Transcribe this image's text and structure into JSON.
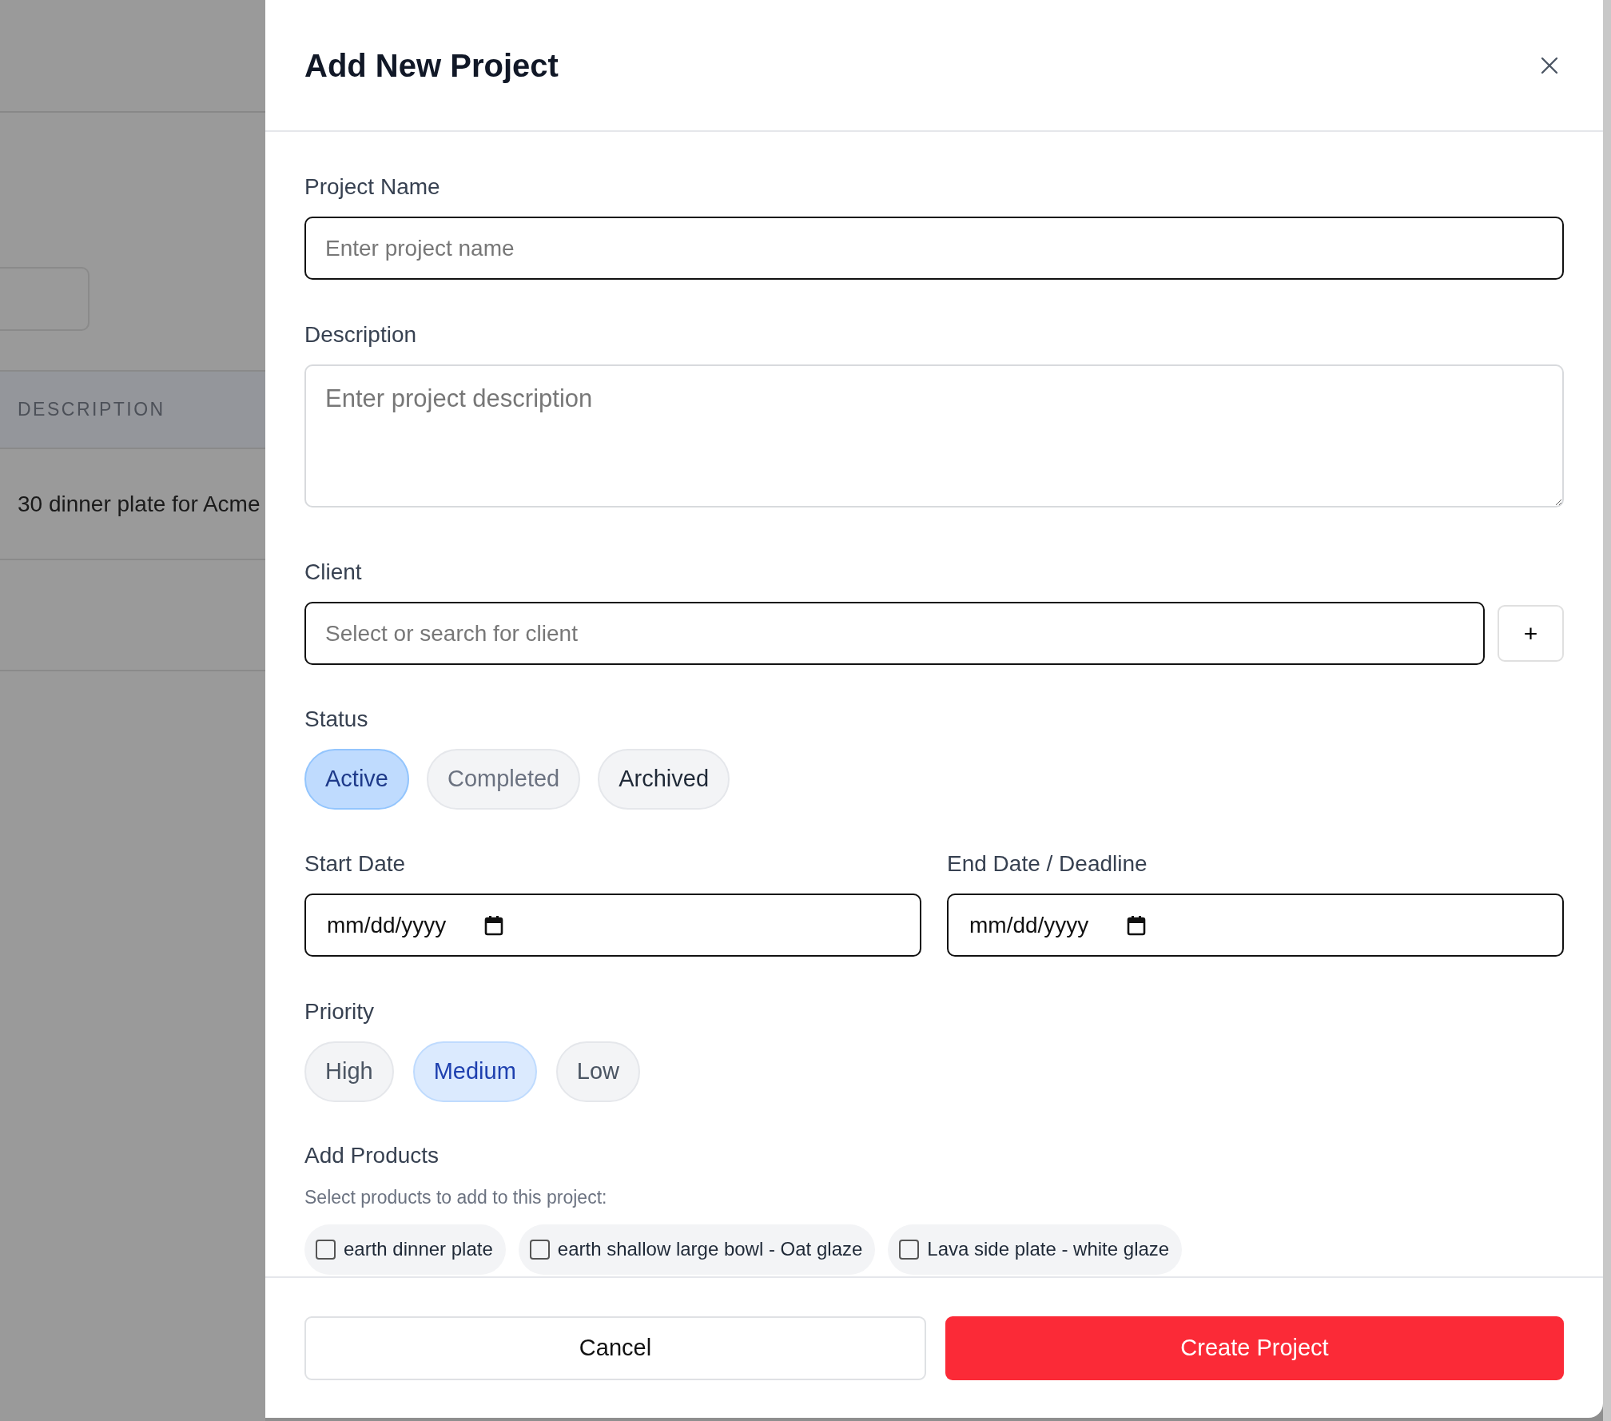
{
  "background": {
    "table": {
      "columns": [
        "DESCRIPTION"
      ],
      "rows": [
        [
          "30 dinner plate for Acme"
        ]
      ]
    }
  },
  "modal": {
    "title": "Add New Project",
    "fields": {
      "project_name": {
        "label": "Project Name",
        "placeholder": "Enter project name"
      },
      "description": {
        "label": "Description",
        "placeholder": "Enter project description"
      },
      "client": {
        "label": "Client",
        "placeholder": "Select or search for client",
        "add_button": "+"
      }
    },
    "status": {
      "label": "Status",
      "options": [
        {
          "label": "Active",
          "selected": true,
          "disabled": false
        },
        {
          "label": "Completed",
          "selected": false,
          "disabled": true
        },
        {
          "label": "Archived",
          "selected": false,
          "disabled": false
        }
      ]
    },
    "dates": [
      {
        "label": "Start Date",
        "placeholder": "mm/dd/yyyy"
      },
      {
        "label": "End Date / Deadline",
        "placeholder": "mm/dd/yyyy"
      }
    ],
    "priority": {
      "label": "Priority",
      "options": [
        {
          "label": "High",
          "selected": false
        },
        {
          "label": "Medium",
          "selected": true
        },
        {
          "label": "Low",
          "selected": false
        }
      ]
    },
    "products": {
      "label": "Add Products",
      "hint": "Select products to add to this project:",
      "items": [
        {
          "label": "earth dinner plate",
          "checked": false
        },
        {
          "label": "earth shallow large bowl - Oat glaze",
          "checked": false
        },
        {
          "label": "Lava side plate - white glaze",
          "checked": false
        }
      ]
    },
    "buttons": {
      "cancel": "Cancel",
      "submit": "Create Project"
    }
  }
}
